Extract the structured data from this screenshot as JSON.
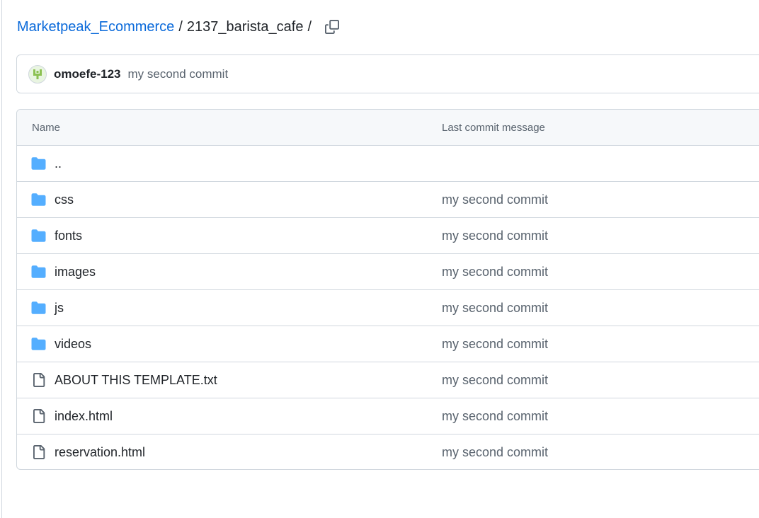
{
  "breadcrumb": {
    "repo": "Marketpeak_Ecommerce",
    "separator": "/",
    "folder": "2137_barista_cafe",
    "trailing_separator": "/",
    "copy_icon": "copy-icon"
  },
  "latest_commit": {
    "author": "omoefe-123",
    "message": "my second commit"
  },
  "table": {
    "headers": {
      "name": "Name",
      "last_commit_message": "Last commit message"
    },
    "rows": [
      {
        "type": "folder",
        "name": "..",
        "message": ""
      },
      {
        "type": "folder",
        "name": "css",
        "message": "my second commit"
      },
      {
        "type": "folder",
        "name": "fonts",
        "message": "my second commit"
      },
      {
        "type": "folder",
        "name": "images",
        "message": "my second commit"
      },
      {
        "type": "folder",
        "name": "js",
        "message": "my second commit"
      },
      {
        "type": "folder",
        "name": "videos",
        "message": "my second commit"
      },
      {
        "type": "file",
        "name": "ABOUT THIS TEMPLATE.txt",
        "message": "my second commit"
      },
      {
        "type": "file",
        "name": "index.html",
        "message": "my second commit"
      },
      {
        "type": "file",
        "name": "reservation.html",
        "message": "my second commit"
      }
    ]
  },
  "colors": {
    "link": "#0969da",
    "folder": "#54aeff",
    "file_icon": "#59636e",
    "border": "#d0d7de",
    "header_bg": "#f6f8fa",
    "muted_text": "#59636e"
  }
}
